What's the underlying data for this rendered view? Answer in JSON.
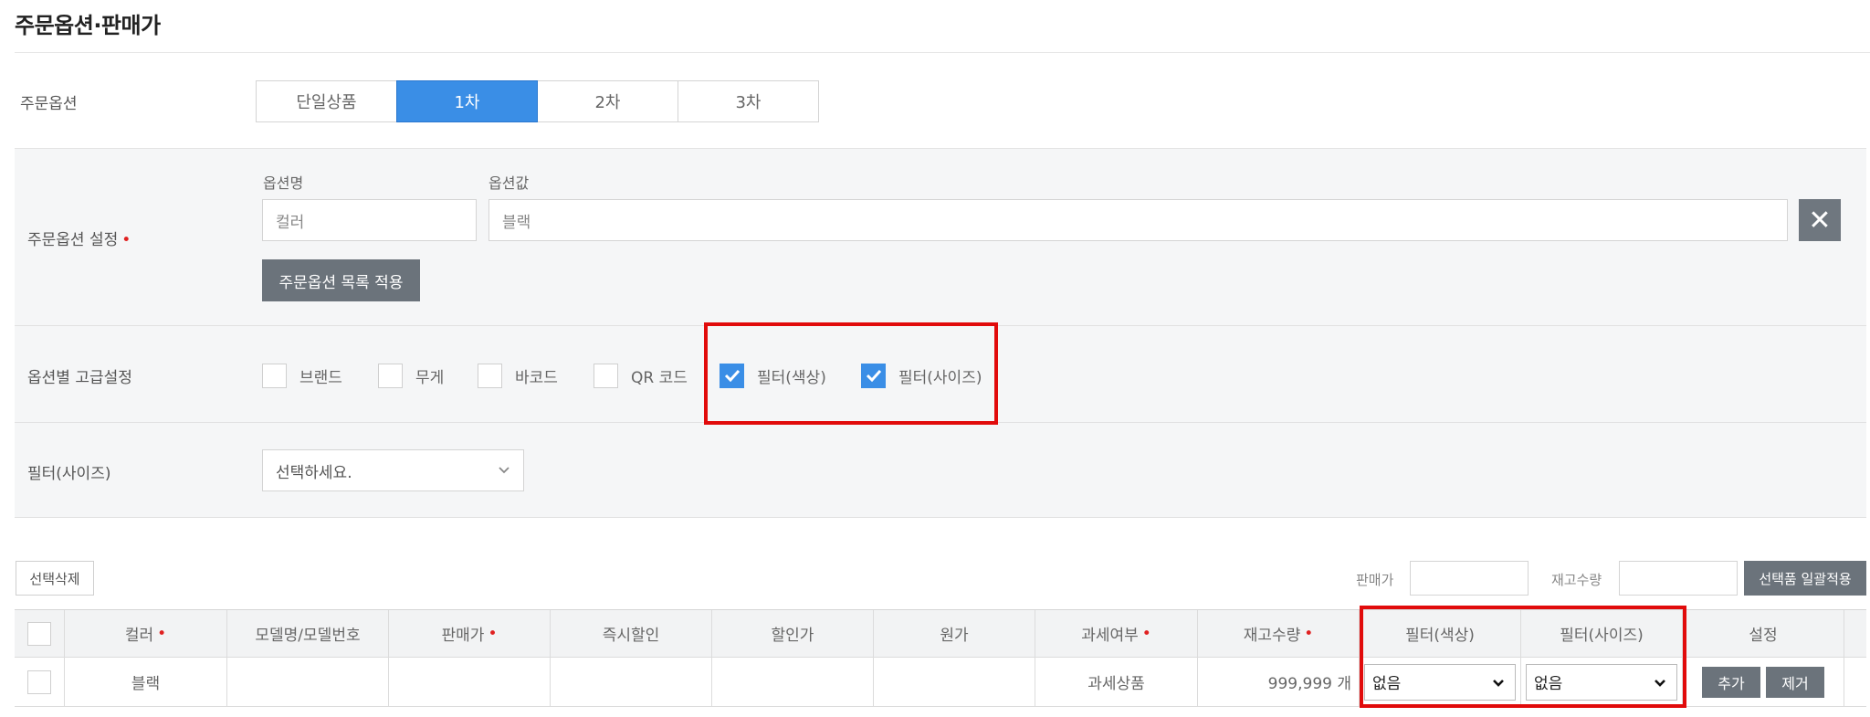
{
  "page": {
    "title": "주문옵션·판매가"
  },
  "order_option": {
    "label": "주문옵션",
    "tabs": [
      {
        "label": "단일상품",
        "active": false
      },
      {
        "label": "1차",
        "active": true
      },
      {
        "label": "2차",
        "active": false
      },
      {
        "label": "3차",
        "active": false
      }
    ]
  },
  "option_setting": {
    "label": "주문옵션 설정",
    "name_label": "옵션명",
    "value_label": "옵션값",
    "name_value": "컬러",
    "value_value": "블랙",
    "apply_button": "주문옵션 목록 적용",
    "close_icon": "close-icon"
  },
  "advanced": {
    "label": "옵션별 고급설정",
    "checkboxes": [
      {
        "label": "브랜드",
        "checked": false
      },
      {
        "label": "무게",
        "checked": false
      },
      {
        "label": "바코드",
        "checked": false
      },
      {
        "label": "QR 코드",
        "checked": false
      },
      {
        "label": "필터(색상)",
        "checked": true
      },
      {
        "label": "필터(사이즈)",
        "checked": true
      }
    ]
  },
  "filter_size": {
    "label": "필터(사이즈)",
    "select_value": "선택하세요."
  },
  "table_toolbar": {
    "delete_selected": "선택삭제",
    "price_label": "판매가",
    "stock_label": "재고수량",
    "bulk_apply": "선택품 일괄적용"
  },
  "table": {
    "headers": [
      "컬러",
      "모델명/모델번호",
      "판매가",
      "즉시할인",
      "할인가",
      "원가",
      "과세여부",
      "재고수량",
      "필터(색상)",
      "필터(사이즈)",
      "설정"
    ],
    "required": [
      true,
      false,
      true,
      false,
      false,
      false,
      true,
      true,
      false,
      false,
      false
    ],
    "row": {
      "color": "블랙",
      "model": "",
      "price": "",
      "instant_discount": "",
      "discount_price": "",
      "cost": "",
      "tax": "과세상품",
      "stock": "999,999 개",
      "filter_color": "없음",
      "filter_size": "없음",
      "add_button": "추가",
      "remove_button": "제거"
    }
  },
  "colors": {
    "accent": "#3a8ee6",
    "highlight": "#e10b0b",
    "dark_button": "#6b737b"
  }
}
